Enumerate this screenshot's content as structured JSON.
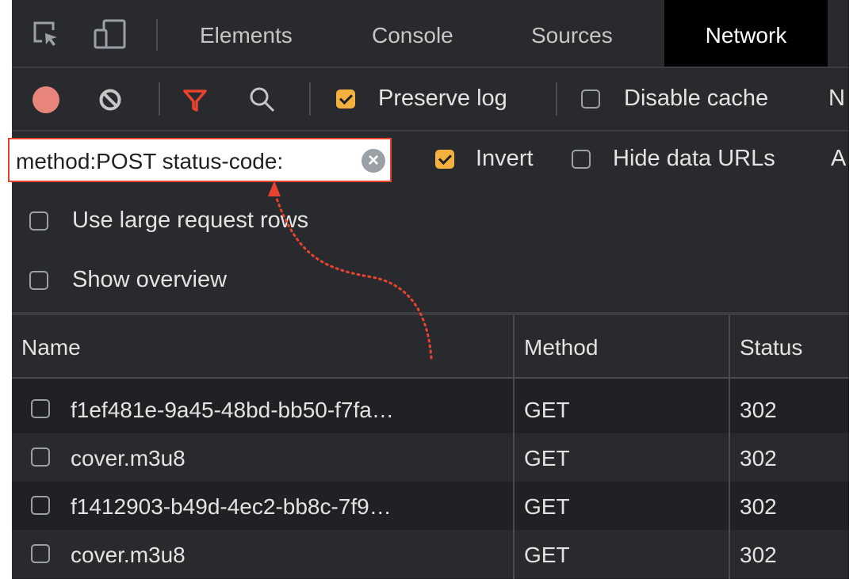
{
  "tabs": {
    "items": [
      {
        "label": "Elements"
      },
      {
        "label": "Console"
      },
      {
        "label": "Sources"
      },
      {
        "label": "Network"
      }
    ]
  },
  "toolbar": {
    "preserve_log": {
      "label": "Preserve log",
      "checked": true
    },
    "disable_cache": {
      "label": "Disable cache",
      "checked": false
    },
    "overflow_label": "N"
  },
  "filter": {
    "value": "method:POST status-code:",
    "invert": {
      "label": "Invert",
      "checked": true
    },
    "hide_data_urls": {
      "label": "Hide data URLs",
      "checked": false
    },
    "overflow_label": "A"
  },
  "settings": {
    "large_rows": {
      "label": "Use large request rows",
      "checked": false
    },
    "overview": {
      "label": "Show overview",
      "checked": false
    }
  },
  "table": {
    "columns": [
      "Name",
      "Method",
      "Status"
    ],
    "rows": [
      {
        "name": "f1ef481e-9a45-48bd-bb50-f7fa…",
        "method": "GET",
        "status": "302"
      },
      {
        "name": "cover.m3u8",
        "method": "GET",
        "status": "302"
      },
      {
        "name": "f1412903-b49d-4ec2-bb8c-7f9…",
        "method": "GET",
        "status": "302"
      },
      {
        "name": "cover.m3u8",
        "method": "GET",
        "status": "302"
      }
    ]
  },
  "colors": {
    "record": "#e8857a",
    "checkbox_checked": "#f5b13f",
    "filter_icon": "#e8432e",
    "highlight": "#e8432e"
  }
}
